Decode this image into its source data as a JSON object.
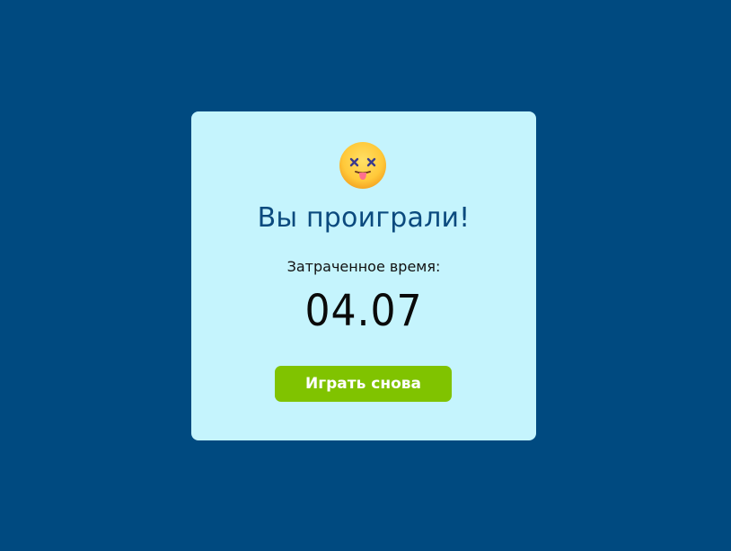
{
  "result": {
    "emoji": "dizzy-face-with-tongue-icon",
    "title": "Вы проиграли!",
    "time_label": "Затраченное время:",
    "time_value": "04.07",
    "play_again_label": "Играть снова"
  },
  "colors": {
    "background": "#004a80",
    "modal": "#c5f4fd",
    "title": "#0b4a7e",
    "button": "#80c300",
    "button_text": "#ffffff"
  }
}
